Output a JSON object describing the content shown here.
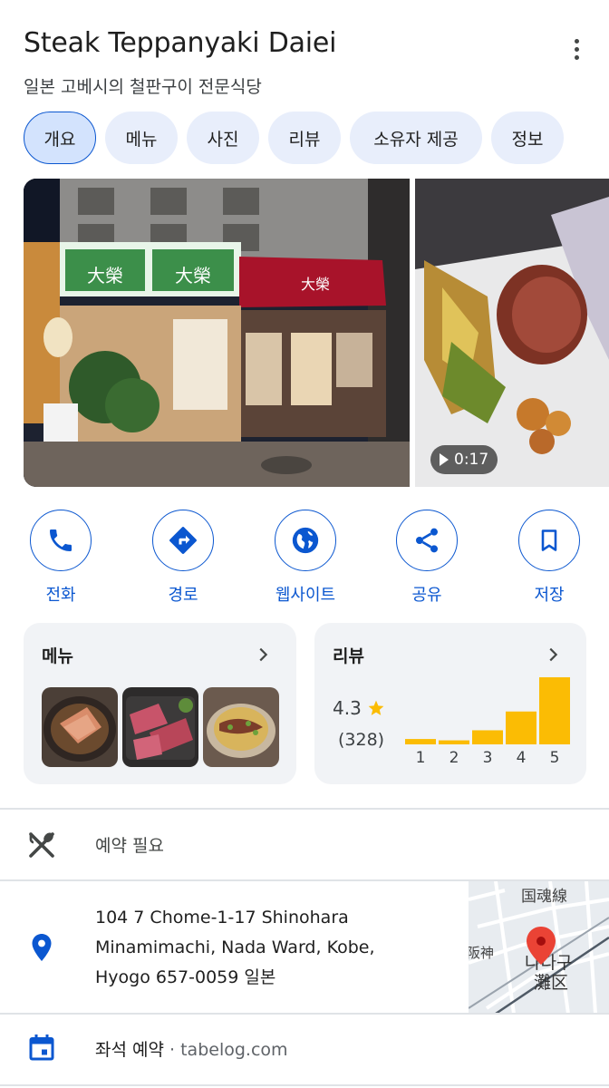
{
  "header": {
    "title": "Steak Teppanyaki Daiei",
    "subtitle": "일본 고베시의 철판구이 전문식당",
    "more_icon": "more-vert-icon"
  },
  "tabs": [
    {
      "label": "개요",
      "active": true
    },
    {
      "label": "메뉴",
      "active": false
    },
    {
      "label": "사진",
      "active": false
    },
    {
      "label": "리뷰",
      "active": false
    },
    {
      "label": "소유자 제공",
      "active": false
    },
    {
      "label": "정보",
      "active": false
    }
  ],
  "photos": {
    "main_sign_text": [
      "大榮",
      "大榮",
      "大榮"
    ],
    "video_duration": "0:17"
  },
  "actions": [
    {
      "label": "전화",
      "icon": "phone-icon"
    },
    {
      "label": "경로",
      "icon": "directions-icon"
    },
    {
      "label": "웹사이트",
      "icon": "globe-icon"
    },
    {
      "label": "공유",
      "icon": "share-icon"
    },
    {
      "label": "저장",
      "icon": "bookmark-icon"
    }
  ],
  "menu_card": {
    "title": "메뉴"
  },
  "review_card": {
    "title": "리뷰",
    "rating": "4.3",
    "count": "(328)"
  },
  "chart_data": {
    "type": "bar",
    "categories": [
      "1",
      "2",
      "3",
      "4",
      "5"
    ],
    "values": [
      0.08,
      0.06,
      0.21,
      0.49,
      1.0
    ],
    "color": "#fbbc04",
    "ylim": [
      0,
      1
    ]
  },
  "reservation": {
    "text": "예약 필요",
    "icon": "restaurant-icon"
  },
  "address": {
    "line1": "104 7 Chome-1-17 Shinohara",
    "line2": "Minamimachi, Nada Ward, Kobe,",
    "line3": "Hyogo 657-0059 일본",
    "icon": "location-pin-icon",
    "map_labels": [
      "国魂線",
      "阪神",
      "나다구",
      "灘区"
    ]
  },
  "booking": {
    "label": "좌석 예약",
    "separator": "·",
    "source": "tabelog.com",
    "icon": "calendar-icon"
  },
  "colors": {
    "accent": "#0b57d0",
    "star": "#fbbc04",
    "tab_bg": "#e8eefb",
    "card_bg": "#f1f3f6",
    "pin": "#ea4335"
  }
}
